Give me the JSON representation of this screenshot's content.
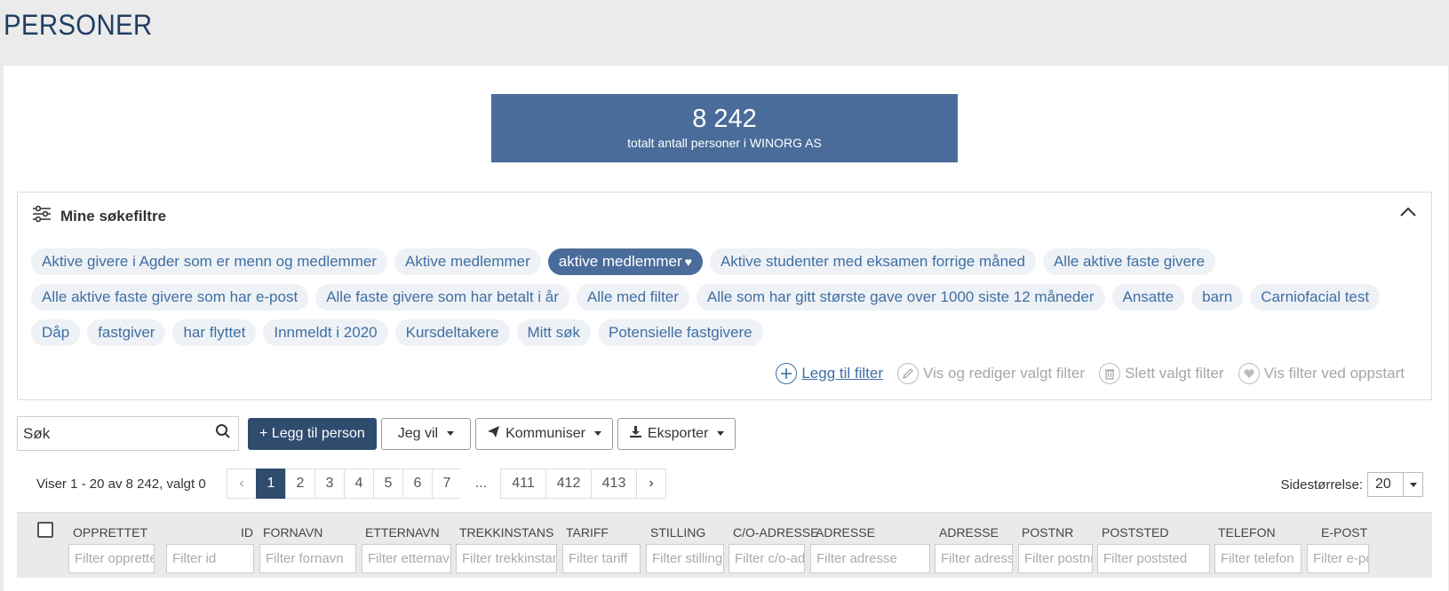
{
  "page": {
    "title": "PERSONER"
  },
  "stats": {
    "total": "8 242",
    "label": "totalt antall personer i WINORG AS"
  },
  "filters": {
    "title": "Mine søkefiltre",
    "rows": [
      [
        {
          "label": "Aktive givere i Agder som er menn og medlemmer"
        },
        {
          "label": "Aktive medlemmer"
        },
        {
          "label": "aktive medlemmer",
          "active": true
        },
        {
          "label": "Aktive studenter med eksamen forrige måned"
        },
        {
          "label": "Alle aktive faste givere"
        }
      ],
      [
        {
          "label": "Alle aktive faste givere som har e-post"
        },
        {
          "label": "Alle faste givere som har betalt i år"
        },
        {
          "label": "Alle med filter"
        },
        {
          "label": "Alle som har gitt største gave over 1000 siste 12 måneder"
        },
        {
          "label": "Ansatte"
        },
        {
          "label": "barn"
        },
        {
          "label": "Carniofacial test"
        }
      ],
      [
        {
          "label": "Dåp"
        },
        {
          "label": "fastgiver"
        },
        {
          "label": "har flyttet"
        },
        {
          "label": "Innmeldt i 2020"
        },
        {
          "label": "Kursdeltakere"
        },
        {
          "label": "Mitt søk"
        },
        {
          "label": "Potensielle fastgivere"
        }
      ]
    ],
    "actions": {
      "add": "Legg til filter",
      "edit": "Vis og rediger valgt filter",
      "delete": "Slett valgt filter",
      "startup": "Vis filter ved oppstart"
    }
  },
  "toolbar": {
    "search_placeholder": "Søk",
    "add_person": "+ Legg til person",
    "jeg_vil": "Jeg vil",
    "kommuniser": "Kommuniser",
    "eksporter": "Eksporter"
  },
  "pagination": {
    "showing": "Viser 1 - 20 av 8 242, valgt 0",
    "pages": [
      "1",
      "2",
      "3",
      "4",
      "5",
      "6",
      "7"
    ],
    "ellipsis": "...",
    "last_pages": [
      "411",
      "412",
      "413"
    ],
    "page_size_label": "Sidestørrelse:",
    "page_size": "20"
  },
  "columns": [
    {
      "header": "OPPRETTET",
      "filter": "Filter opprettet"
    },
    {
      "header": "ID",
      "filter": "Filter id"
    },
    {
      "header": "FORNAVN",
      "filter": "Filter fornavn"
    },
    {
      "header": "ETTERNAVN",
      "filter": "Filter etternavn"
    },
    {
      "header": "TREKKINSTANS",
      "filter": "Filter trekkinstans"
    },
    {
      "header": "TARIFF",
      "filter": "Filter tariff"
    },
    {
      "header": "STILLING",
      "filter": "Filter stilling"
    },
    {
      "header": "C/O-ADRESSE",
      "filter": "Filter c/o-adresse"
    },
    {
      "header": "ADRESSE",
      "filter": "Filter adresse"
    },
    {
      "header": "ADRESSE",
      "filter": "Filter adresse"
    },
    {
      "header": "POSTNR",
      "filter": "Filter postnr"
    },
    {
      "header": "POSTSTED",
      "filter": "Filter poststed"
    },
    {
      "header": "TELEFON",
      "filter": "Filter telefon"
    },
    {
      "header": "E-POST",
      "filter": "Filter e-post"
    }
  ],
  "colors": {
    "brand": "#4a6c9a",
    "dark": "#2f4b6e",
    "link": "#3f6fa4"
  }
}
